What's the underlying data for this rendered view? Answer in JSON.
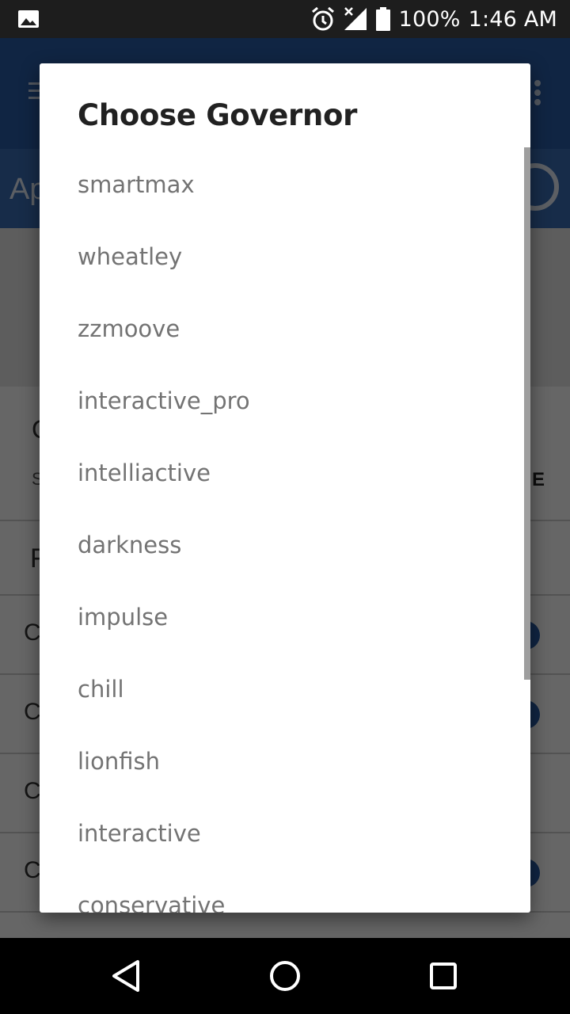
{
  "status_bar": {
    "battery_percent": "100%",
    "time": "1:46 AM",
    "icons": [
      "gallery-icon",
      "alarm-icon",
      "signal-icon",
      "battery-icon"
    ]
  },
  "background_app": {
    "subbar_title": "Ap",
    "card_title": "C",
    "card_subtitle": "S",
    "card_action": "E",
    "section_title": "F",
    "rows": [
      "C",
      "C",
      "C",
      "C"
    ]
  },
  "dialog": {
    "title": "Choose Governor",
    "options": [
      "smartmax",
      "wheatley",
      "zzmoove",
      "interactive_pro",
      "intelliactive",
      "darkness",
      "impulse",
      "chill",
      "lionfish",
      "interactive",
      "conservative"
    ]
  },
  "colors": {
    "primary": "#2a5ea8",
    "status_bar": "#1d1d1d",
    "option_text": "#737373",
    "title_text": "#212121"
  }
}
